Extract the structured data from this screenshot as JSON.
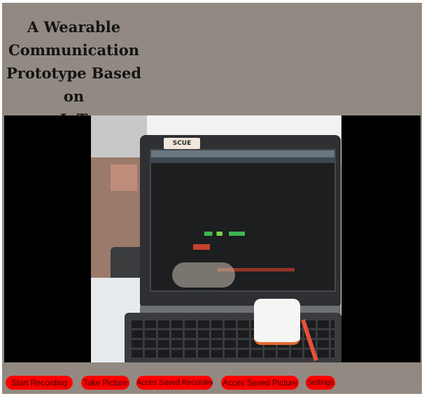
{
  "header": {
    "title": "A Wearable\nCommunication\nPrototype Based on\nIoT"
  },
  "video": {
    "sticker_text": "SCUE"
  },
  "controls": {
    "start_recording": "Start Recording",
    "take_picture": "Take Picture",
    "access_saved_recording": "Acces Saved Recording",
    "access_saved_picture": "Acces Saved Picture",
    "settings": "Settings"
  },
  "colors": {
    "background": "#928a82",
    "button": "#ff0000",
    "video_bg": "#000000"
  }
}
